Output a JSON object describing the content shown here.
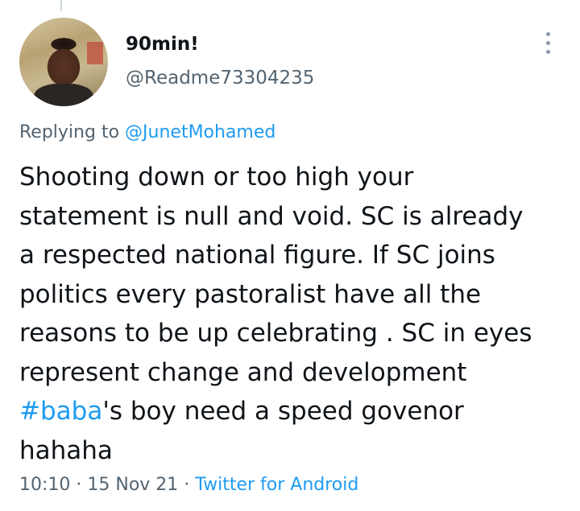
{
  "author": {
    "display_name": "90min!",
    "handle": "@Readme73304235"
  },
  "reply": {
    "prefix": "Replying to ",
    "to_handle": "@JunetMohamed"
  },
  "tweet": {
    "lines": [
      "Shooting down or too high your",
      "statement is null and void. SC is already",
      "a respected national figure. If SC joins",
      "politics every pastoralist have all the",
      "reasons to be up celebrating . SC in eyes",
      "represent change and development"
    ],
    "hashtag": "#baba",
    "after_hashtag": "'s boy  need a speed govenor",
    "last_line": "hahaha"
  },
  "meta": {
    "time": "10:10",
    "separator": " · ",
    "date": "15 Nov 21",
    "source": "Twitter for Android"
  },
  "icons": {
    "more": "more-vertical-icon"
  },
  "colors": {
    "link": "#1d9bf0",
    "secondary_text": "#536471",
    "primary_text": "#0f1419"
  }
}
